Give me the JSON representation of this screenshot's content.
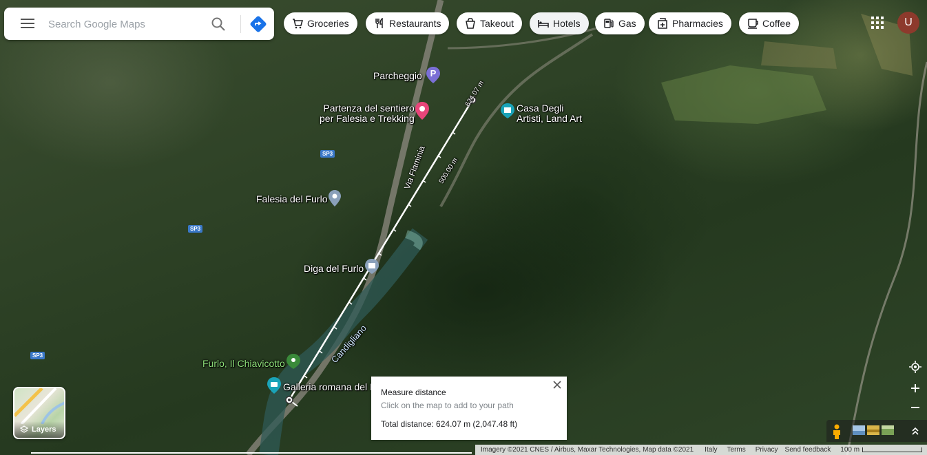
{
  "search": {
    "placeholder": "Search Google Maps"
  },
  "chips": [
    {
      "label": "Groceries",
      "icon": "cart-icon"
    },
    {
      "label": "Restaurants",
      "icon": "cutlery-icon"
    },
    {
      "label": "Takeout",
      "icon": "takeout-icon"
    },
    {
      "label": "Hotels",
      "icon": "bed-icon"
    },
    {
      "label": "Gas",
      "icon": "gas-pump-icon"
    },
    {
      "label": "Pharmacies",
      "icon": "pharmacy-icon"
    },
    {
      "label": "Coffee",
      "icon": "coffee-icon"
    }
  ],
  "account": {
    "initial": "U",
    "color": "#8d3a2c"
  },
  "map_labels": {
    "parcheggio": "Parcheggio",
    "parking_glyph": "P",
    "partenza_1": "Partenza del sentiero",
    "partenza_2": "per Falesia e Trekking",
    "casa_1": "Casa Degli",
    "casa_2": "Artisti, Land Art",
    "via_flaminia": "Via Flaminia",
    "falesia": "Falesia del Furlo",
    "diga": "Diga del Furlo",
    "candigliano": "Candigliano",
    "chiavicotto": "Furlo, Il Chiavicotto",
    "galleria": "Galleria romana del F",
    "road_sp3": "SP3",
    "distance_500": "500.00 m",
    "distance_624": "624.07 m"
  },
  "layers": {
    "label": "Layers"
  },
  "measure": {
    "title": "Measure distance",
    "hint": "Click on the map to add to your path",
    "total": "Total distance: 624.07 m (2,047.48 ft)"
  },
  "footer": {
    "attribution": "Imagery ©2021 CNES / Airbus, Maxar Technologies, Map data ©2021",
    "country": "Italy",
    "terms": "Terms",
    "privacy": "Privacy",
    "feedback": "Send feedback",
    "scale": "100 m"
  },
  "colors": {
    "measure_line": "#ffffff",
    "map_green": "#2e4226",
    "sp3_badge": "#3a78c8"
  }
}
